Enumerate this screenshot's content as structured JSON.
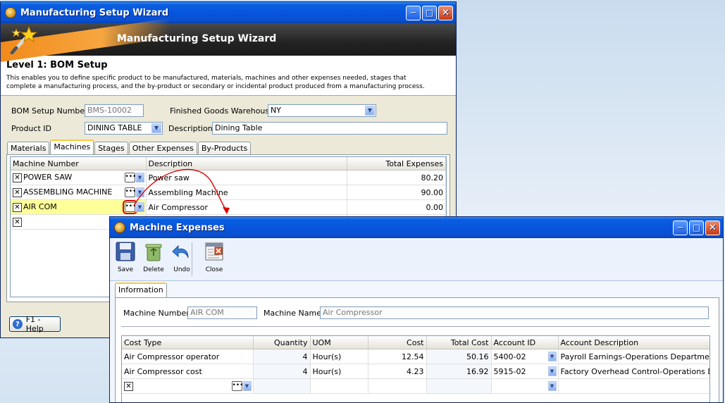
{
  "wizard": {
    "title": "Manufacturing Setup Wizard",
    "banner_title": "Manufacturing Setup Wizard",
    "level_title": "Level 1: BOM Setup",
    "description_line1": "This enables you to define specific product to be manufactured, materials, machines and other expenses needed, stages that",
    "description_line2": "complete a manufacturing process, and the by-product or secondary or incidental product produced from a manufacturing process.",
    "bom_label": "BOM Setup Number",
    "bom_value": "BMS-10002",
    "fgw_label": "Finished Goods Warehouse",
    "fgw_value": "NY",
    "product_label": "Product ID",
    "product_value": "DINING TABLE",
    "desc_label": "Description",
    "desc_value": "Dining Table",
    "tabs": [
      "Materials",
      "Machines",
      "Stages",
      "Other Expenses",
      "By-Products"
    ],
    "grid": {
      "headers": [
        "Machine Number",
        "Description",
        "Total Expenses"
      ],
      "rows": [
        {
          "number": "POWER SAW",
          "description": "Power saw",
          "total": "80.20"
        },
        {
          "number": "ASSEMBLING MACHINE",
          "description": "Assembling Machine",
          "total": "90.00"
        },
        {
          "number": "AIR COM",
          "description": "Air Compressor",
          "total": "0.00"
        }
      ]
    },
    "help_label": "F1 - Help"
  },
  "expenses": {
    "title": "Machine Expenses",
    "toolbar": {
      "save": "Save",
      "delete": "Delete",
      "undo": "Undo",
      "close": "Close"
    },
    "tab": "Information",
    "machine_number_label": "Machine Number",
    "machine_number_value": "AIR COM",
    "machine_name_label": "Machine Name",
    "machine_name_value": "Air Compressor",
    "grid": {
      "headers": [
        "Cost Type",
        "Quantity",
        "UOM",
        "Cost",
        "Total Cost",
        "Account ID",
        "Account Description"
      ],
      "rows": [
        {
          "type": "Air Compressor operator",
          "qty": "4",
          "uom": "Hour(s)",
          "cost": "12.54",
          "total": "50.16",
          "account": "5400-02",
          "acct_desc": "Payroll Earnings-Operations Department"
        },
        {
          "type": "Air Compressor cost",
          "qty": "4",
          "uom": "Hour(s)",
          "cost": "4.23",
          "total": "16.92",
          "account": "5915-02",
          "acct_desc": "Factory Overhead Control-Operations Department"
        }
      ]
    }
  },
  "colors": {
    "titlebar": "#0855dd",
    "highlight_row": "#ffff99",
    "annotation": "#e00000"
  }
}
